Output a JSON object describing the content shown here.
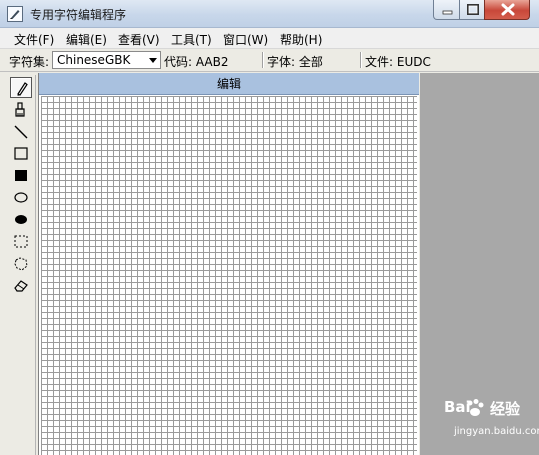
{
  "window": {
    "title": "专用字符编辑程序"
  },
  "menu": {
    "items": [
      {
        "label": "文件(F)"
      },
      {
        "label": "编辑(E)"
      },
      {
        "label": "查看(V)"
      },
      {
        "label": "工具(T)"
      },
      {
        "label": "窗口(W)"
      },
      {
        "label": "帮助(H)"
      }
    ]
  },
  "infobar": {
    "charset_label": "字符集:",
    "charset_value": "ChineseGBK",
    "code": "代码: AAB2",
    "font": "字体: 全部",
    "file": "文件: EUDC"
  },
  "tools": [
    {
      "icon": "pencil-icon",
      "selected": true
    },
    {
      "icon": "brush-icon"
    },
    {
      "icon": "line-icon"
    },
    {
      "icon": "rectangle-outline-icon"
    },
    {
      "icon": "rectangle-filled-icon"
    },
    {
      "icon": "ellipse-outline-icon"
    },
    {
      "icon": "ellipse-filled-icon"
    },
    {
      "icon": "rect-select-icon"
    },
    {
      "icon": "freeform-select-icon"
    },
    {
      "icon": "eraser-icon"
    }
  ],
  "editor": {
    "header": "编辑"
  },
  "watermark": {
    "brand": "Bai",
    "brand2": "经验",
    "url": "jingyan.baidu.com"
  },
  "colors": {
    "titlebar": "#c8d7ea",
    "header": "#a9c1df",
    "grid_line": "#9a9a9a",
    "side_pane": "#a8a8a8"
  }
}
